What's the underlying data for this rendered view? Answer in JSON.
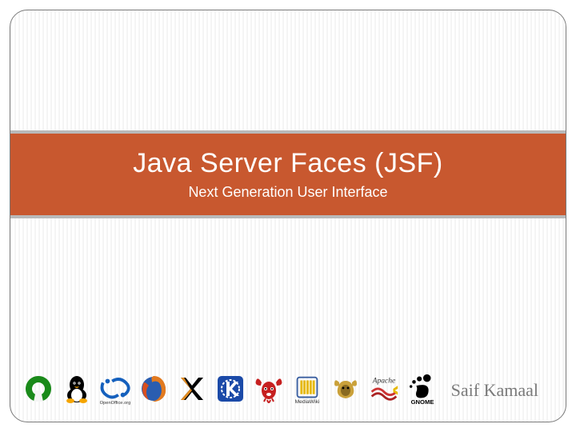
{
  "title": {
    "main": "Java Server Faces (JSF)",
    "subtitle": "Next Generation User Interface"
  },
  "author": "Saif Kamaal",
  "colors": {
    "band": "#c8582f",
    "band_border": "#b9b9b9",
    "author_text": "#7a7a7a"
  },
  "logos": [
    {
      "name": "opensource-icon",
      "label": "Open Source Initiative"
    },
    {
      "name": "tux-icon",
      "label": "Linux Tux"
    },
    {
      "name": "openoffice-icon",
      "label": "OpenOffice.org"
    },
    {
      "name": "firefox-icon",
      "label": "Firefox"
    },
    {
      "name": "xorg-icon",
      "label": "X.Org"
    },
    {
      "name": "kde-icon",
      "label": "KDE"
    },
    {
      "name": "freebsd-icon",
      "label": "FreeBSD"
    },
    {
      "name": "mediawiki-icon",
      "label": "MediaWiki"
    },
    {
      "name": "gnu-icon",
      "label": "GNU"
    },
    {
      "name": "apache-icon",
      "label": "Apache"
    },
    {
      "name": "gnome-icon",
      "label": "GNOME"
    }
  ]
}
